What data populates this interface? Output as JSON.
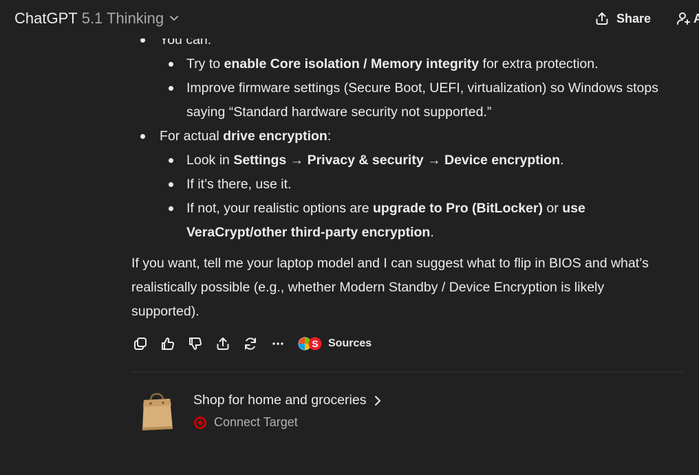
{
  "header": {
    "model_name": "ChatGPT",
    "model_variant": "5.1 Thinking",
    "share_label": "Share",
    "add_user_label": "A"
  },
  "message": {
    "line_0": "You can:",
    "line_1a": "Try to ",
    "line_1b": "enable Core isolation / Memory integrity",
    "line_1c": " for extra protection.",
    "line_2": "Improve firmware settings (Secure Boot, UEFI, virtualization) so Windows stops",
    "line_3": "saying “Standard hardware security not supported.”",
    "line_4a": "For actual ",
    "line_4b": "drive encryption",
    "line_4c": ":",
    "line_5a": "Look in ",
    "line_5b": "Settings → Privacy & security → Device encryption",
    "line_5c": ".",
    "line_6": "If it’s there, use it.",
    "line_7a": "If not, your realistic options are ",
    "line_7b": "upgrade to Pro (BitLocker)",
    "line_7c": " or ",
    "line_7d": "use",
    "line_8a": "VeraCrypt/other third-party encryption",
    "line_8b": ".",
    "para_1": "If you want, tell me your laptop model and I can suggest what to flip in BIOS and what’s",
    "para_2": "realistically possible (e.g., whether Modern Standby / Device Encryption is likely",
    "para_3": "supported)."
  },
  "actions": {
    "icons": [
      "copy-icon",
      "thumbs-up-icon",
      "thumbs-down-icon",
      "share-icon",
      "regenerate-icon",
      "more-icon"
    ],
    "sources_label": "Sources",
    "sources_badge": "S"
  },
  "shop": {
    "title": "Shop for home and groceries",
    "subtitle": "Connect Target",
    "target_color": "#cc0000"
  },
  "colors": {
    "background": "#212121",
    "text": "#ececec",
    "muted": "#a9a9a9"
  }
}
